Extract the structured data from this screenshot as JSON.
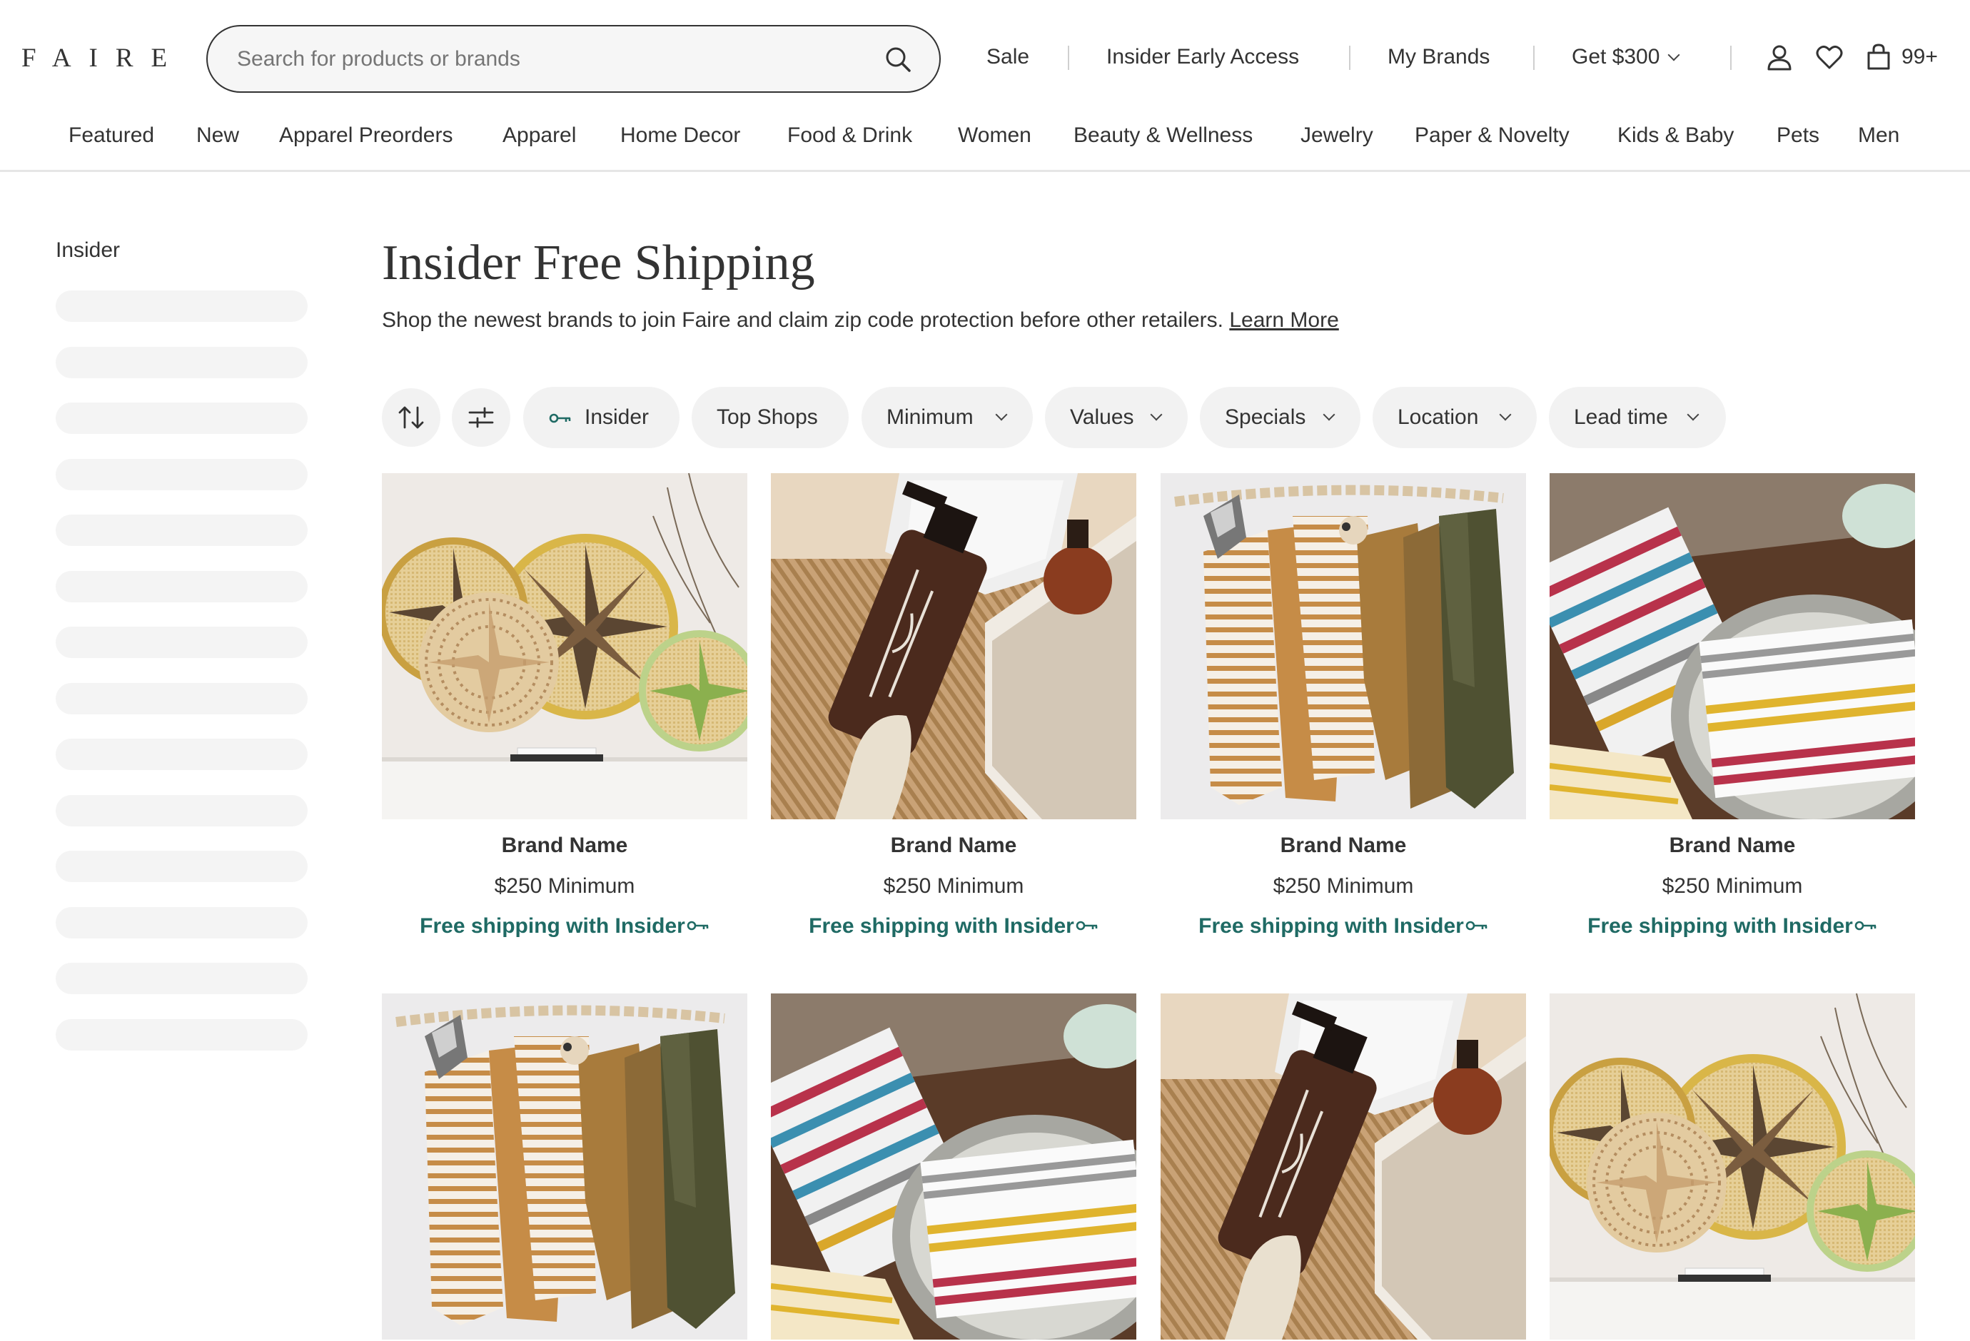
{
  "logo": "FAIRE",
  "search": {
    "placeholder": "Search for products or brands"
  },
  "topnav": {
    "sale": "Sale",
    "insider_early_access": "Insider Early Access",
    "my_brands": "My Brands",
    "get_300": "Get $300",
    "cart_count": "99+"
  },
  "categories": [
    "Featured",
    "New",
    "Apparel Preorders",
    "Apparel",
    "Home Decor",
    "Food & Drink",
    "Women",
    "Beauty & Wellness",
    "Jewelry",
    "Paper & Novelty",
    "Kids & Baby",
    "Pets",
    "Men"
  ],
  "sidebar": {
    "title": "Insider"
  },
  "main": {
    "title": "Insider Free Shipping",
    "subtitle": "Shop the newest brands to join Faire and claim zip code protection before other retailers.",
    "learn_more": "Learn More"
  },
  "filters": {
    "insider": "Insider",
    "top_shops": "Top Shops",
    "minimum": "Minimum",
    "values": "Values",
    "specials": "Specials",
    "location": "Location",
    "lead_time": "Lead time"
  },
  "products": [
    {
      "brand": "Brand Name",
      "minimum": "$250 Minimum",
      "shipping": "Free shipping with Insider",
      "image": "woven-baskets"
    },
    {
      "brand": "Brand Name",
      "minimum": "$250 Minimum",
      "shipping": "Free shipping with Insider",
      "image": "soap-bottle"
    },
    {
      "brand": "Brand Name",
      "minimum": "$250 Minimum",
      "shipping": "Free shipping with Insider",
      "image": "baby-clothes"
    },
    {
      "brand": "Brand Name",
      "minimum": "$250 Minimum",
      "shipping": "Free shipping with Insider",
      "image": "striped-napkins"
    },
    {
      "image": "baby-clothes"
    },
    {
      "image": "striped-napkins"
    },
    {
      "image": "soap-bottle"
    },
    {
      "image": "woven-baskets"
    }
  ],
  "colors": {
    "accent_teal": "#1f6a64",
    "chip_bg": "#f2f2f2",
    "skeleton": "#f4f4f4"
  }
}
